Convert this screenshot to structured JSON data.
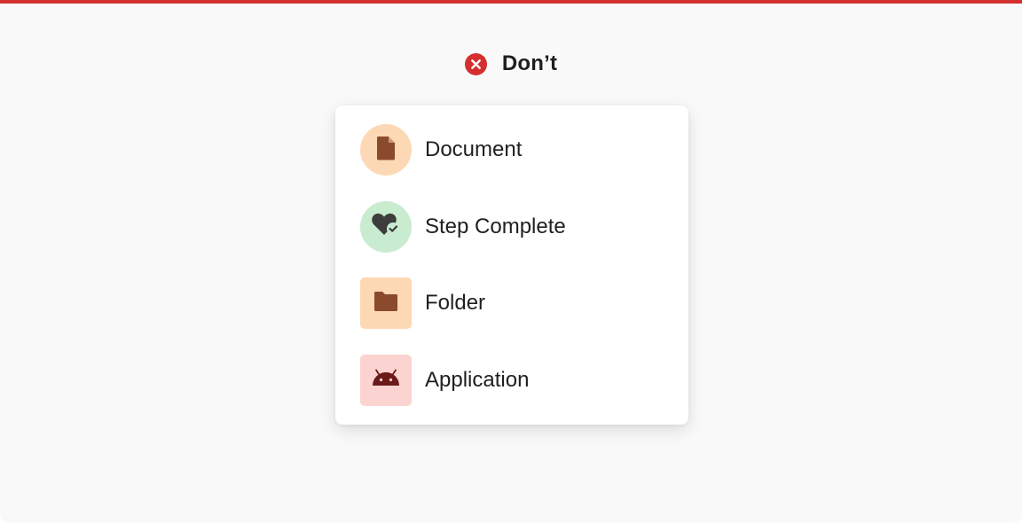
{
  "header": {
    "status_icon": "close-circle-icon",
    "status_label": "Don’t",
    "status_color": "#d3302f"
  },
  "list": {
    "items": [
      {
        "label": "Document",
        "icon": "document-icon",
        "shape": "circle",
        "background": "#fdd8b5",
        "icon_color": "#8b4a2b"
      },
      {
        "label": "Step Complete",
        "icon": "heart-check-icon",
        "shape": "circle",
        "background": "#c9ebcf",
        "icon_color": "#3d3d3d"
      },
      {
        "label": "Folder",
        "icon": "folder-icon",
        "shape": "square",
        "background": "#fdd8b5",
        "icon_color": "#8b4a2b"
      },
      {
        "label": "Application",
        "icon": "android-icon",
        "shape": "square",
        "background": "#fbd3d0",
        "icon_color": "#6b1a1a"
      }
    ]
  }
}
